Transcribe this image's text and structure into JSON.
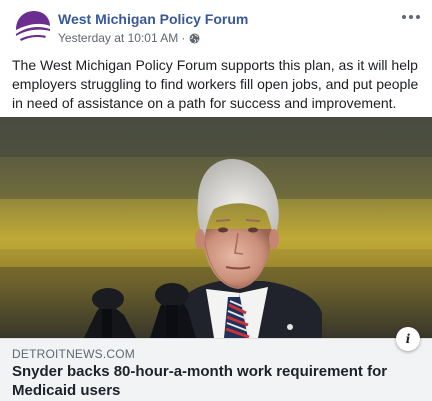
{
  "post": {
    "page_name": "West Michigan Policy Forum",
    "timestamp": "Yesterday at 10:01 AM",
    "separator": "·",
    "privacy_icon": "globe-icon",
    "text": "The West Michigan Policy Forum supports this plan, as it will help employers struggling to find workers fill open jobs, and put people in need of assistance on a path for success and improvement."
  },
  "link_preview": {
    "domain": "DETROITNEWS.COM",
    "title": "Snyder backs 80-hour-a-month work requirement for Medicaid users",
    "info_label": "i"
  },
  "colors": {
    "page_name": "#385898",
    "avatar_purple": "#6b2d8f",
    "link_bg": "#f2f3f5",
    "image_yellow": "#c9b23a"
  }
}
